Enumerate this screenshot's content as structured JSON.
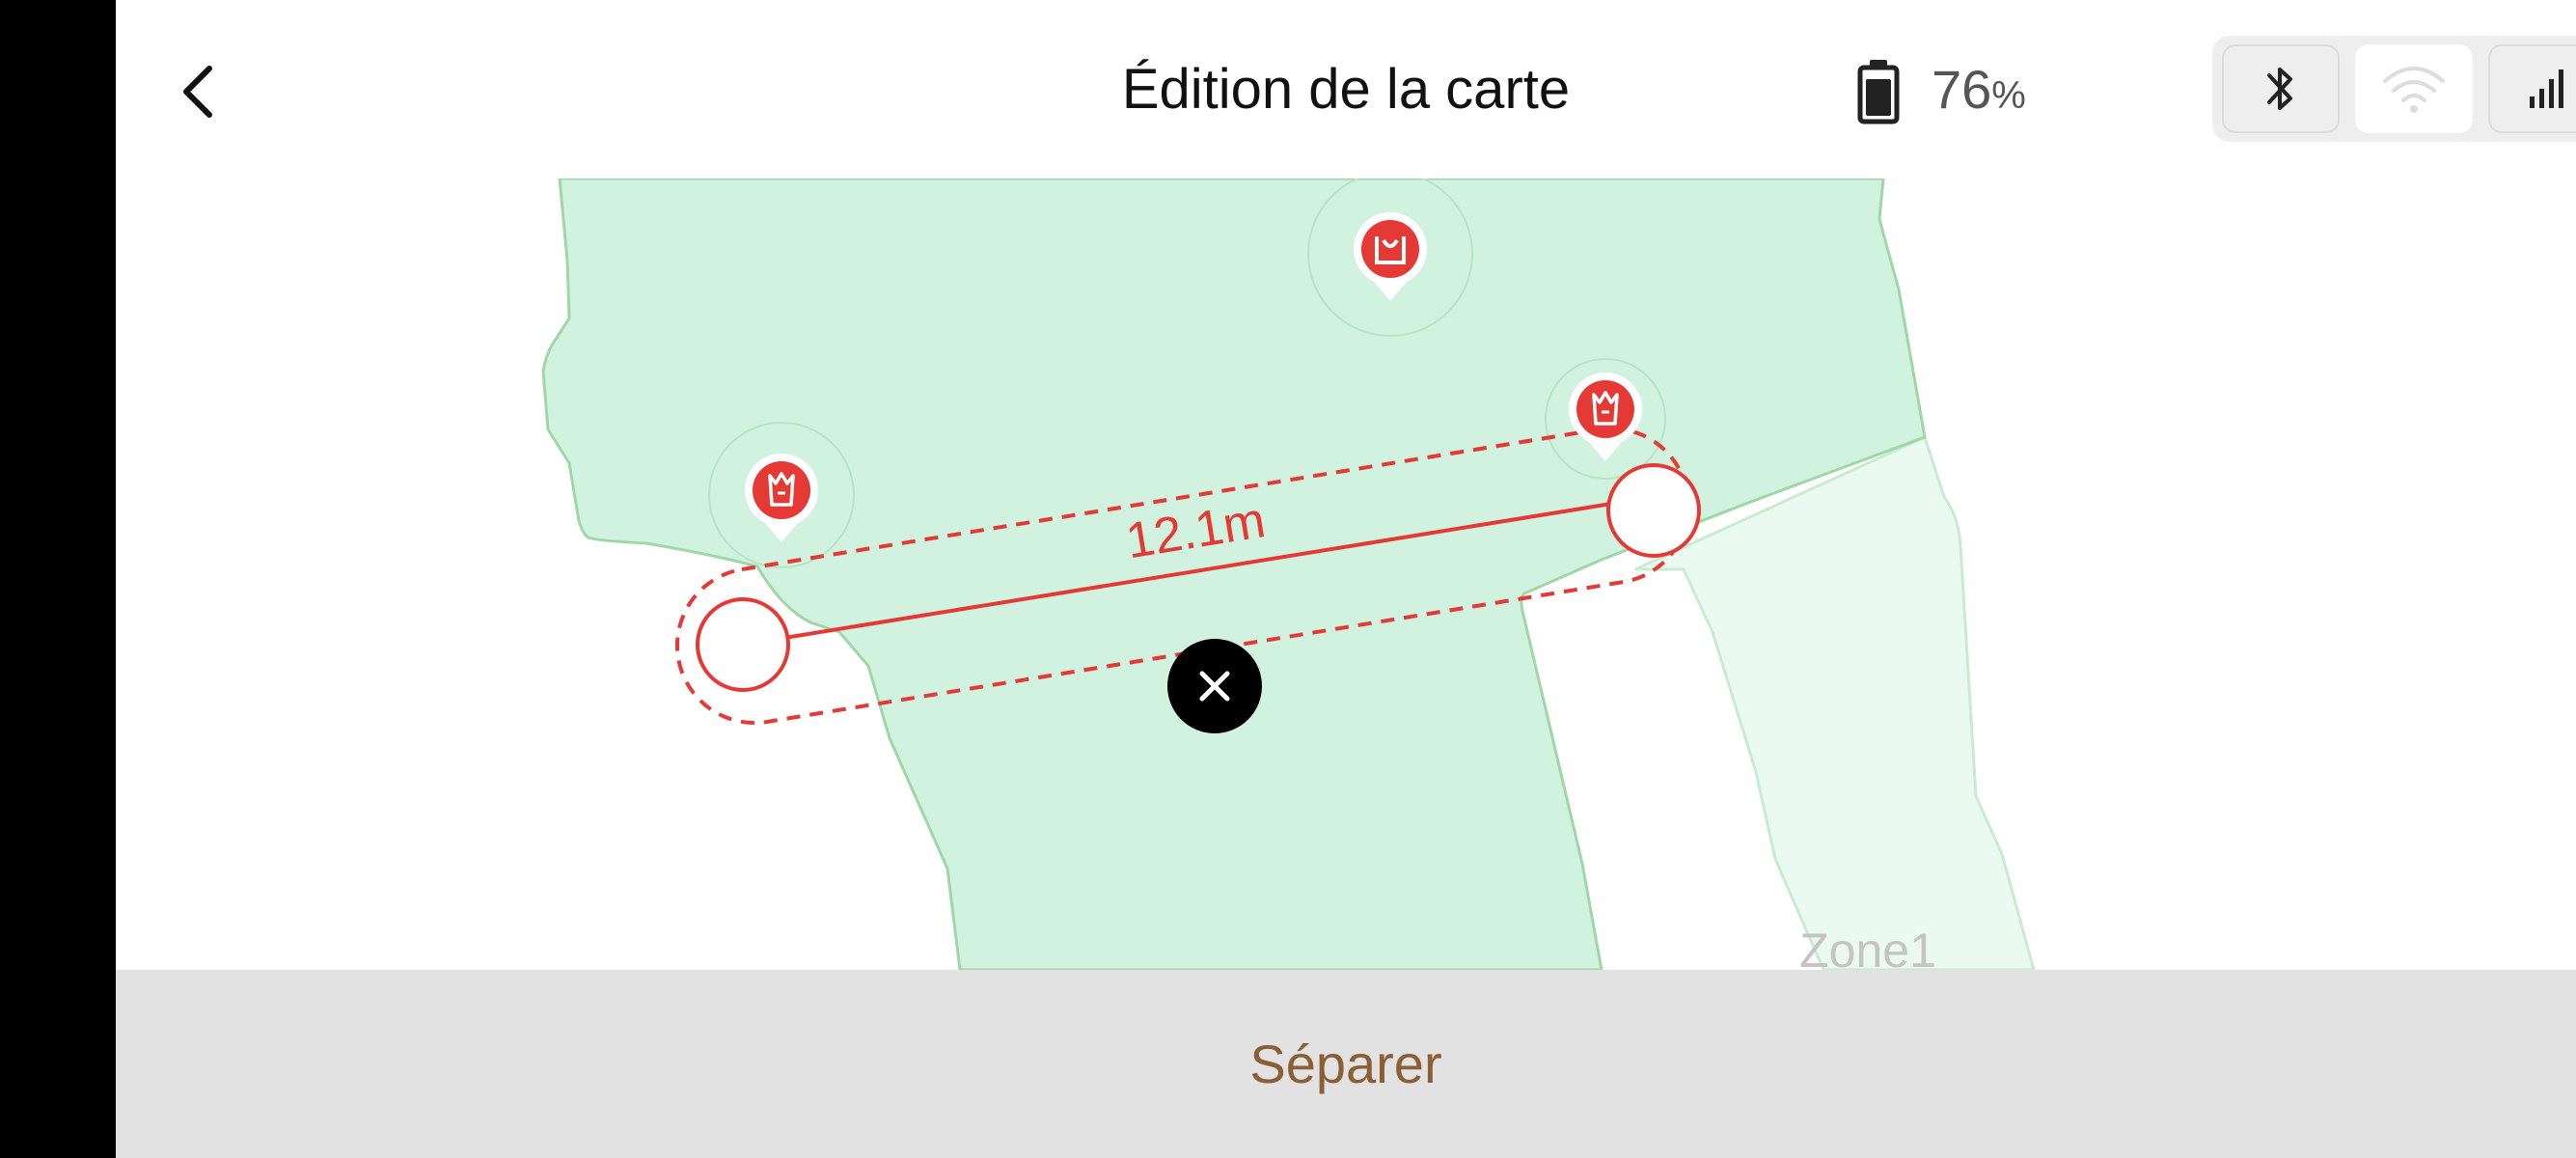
{
  "header": {
    "title": "Édition de la carte",
    "back_icon": "chevron-left-icon",
    "battery": {
      "icon": "battery-icon",
      "value": "76",
      "unit": "%"
    },
    "connectivity": [
      {
        "name": "bluetooth",
        "icon": "bluetooth-icon",
        "active": false
      },
      {
        "name": "wifi",
        "icon": "wifi-icon",
        "active": true
      },
      {
        "name": "cellular",
        "icon": "cellular-signal-icon",
        "active": false
      }
    ]
  },
  "map": {
    "zone_label": "Zone1",
    "measure_label": "12.1m",
    "markers": [
      "base-station-icon",
      "tree-icon",
      "tree-icon"
    ],
    "colors": {
      "zone_fill": "#d0f2df",
      "zone_border": "#9fd8a6",
      "secondary_fill": "#eafaf0",
      "accent": "#e53935"
    }
  },
  "footer": {
    "split_label": "Séparer"
  }
}
